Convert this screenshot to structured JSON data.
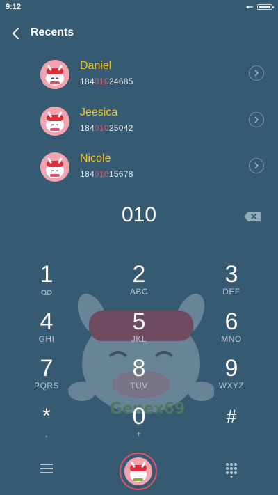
{
  "status_bar": {
    "time": "9:12"
  },
  "header": {
    "title": "Recents",
    "back_icon": "back-chevron-icon"
  },
  "contacts": [
    {
      "name": "Daniel",
      "number_prefix": "184",
      "number_match": "010",
      "number_suffix": "24685"
    },
    {
      "name": "Jeesica",
      "number_prefix": "184",
      "number_match": "010",
      "number_suffix": "25042"
    },
    {
      "name": "Nicole",
      "number_prefix": "184",
      "number_match": "010",
      "number_suffix": "15678"
    }
  ],
  "dialed": "010",
  "keypad": [
    {
      "digit": "1",
      "letters": ""
    },
    {
      "digit": "2",
      "letters": "ABC"
    },
    {
      "digit": "3",
      "letters": "DEF"
    },
    {
      "digit": "4",
      "letters": "GHI"
    },
    {
      "digit": "5",
      "letters": "JKL"
    },
    {
      "digit": "6",
      "letters": "MNO"
    },
    {
      "digit": "7",
      "letters": "PQRS"
    },
    {
      "digit": "8",
      "letters": "TUV"
    },
    {
      "digit": "9",
      "letters": "WXYZ"
    },
    {
      "digit": "*",
      "letters": ","
    },
    {
      "digit": "0",
      "letters": "+"
    },
    {
      "digit": "#",
      "letters": ""
    }
  ],
  "watermark": {
    "text": "Genex69"
  },
  "colors": {
    "background": "#375a73",
    "name_accent": "#f2c21b",
    "match_highlight": "#e0526a"
  }
}
